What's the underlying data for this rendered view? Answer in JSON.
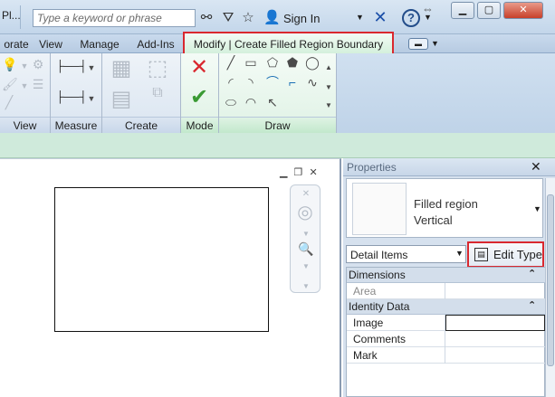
{
  "titlebar": {
    "title": "Pl...",
    "search_placeholder": "Type a keyword or phrase",
    "sign_in_label": "Sign In"
  },
  "tabs": [
    {
      "label": "orate"
    },
    {
      "label": "View"
    },
    {
      "label": "Manage"
    },
    {
      "label": "Add-Ins"
    },
    {
      "label": "Modify | Create Filled Region Boundary"
    }
  ],
  "ribbon": {
    "panels": [
      {
        "label": "View"
      },
      {
        "label": "Measure"
      },
      {
        "label": "Create"
      },
      {
        "label": "Mode"
      },
      {
        "label": "Draw"
      }
    ]
  },
  "properties": {
    "title": "Properties",
    "type_name": "Filled region",
    "type_subname": "Vertical",
    "category": "Detail Items",
    "edit_type_label": "Edit Type",
    "groups": [
      {
        "label": "Dimensions",
        "rows": [
          {
            "label": "Area"
          }
        ]
      },
      {
        "label": "Identity Data",
        "rows": [
          {
            "label": "Image"
          },
          {
            "label": "Comments"
          },
          {
            "label": "Mark"
          }
        ]
      }
    ]
  },
  "colors": {
    "highlight": "#d9282f",
    "contextual_tab": "#cfeadb"
  }
}
